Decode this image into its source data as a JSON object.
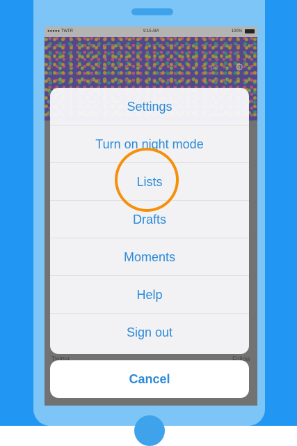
{
  "status_bar": {
    "carrier": "●●●●● TWTR",
    "time": "9:15 AM",
    "battery": "100%"
  },
  "header_icons": [
    "search-icon",
    "gear-icon"
  ],
  "background_rows": [
    "Twitter",
    "Follow"
  ],
  "action_sheet": {
    "items": [
      "Settings",
      "Turn on night mode",
      "Lists",
      "Drafts",
      "Moments",
      "Help",
      "Sign out"
    ],
    "cancel": "Cancel"
  },
  "colors": {
    "frame": "#2196f3",
    "phone_body": "#7cc5f6",
    "ios_blue": "#2c8ad8",
    "highlight": "#f5900a"
  },
  "highlighted_item": "Lists"
}
